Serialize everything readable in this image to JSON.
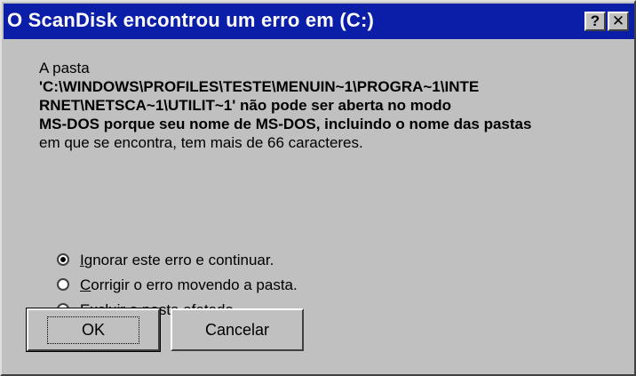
{
  "window": {
    "title": "O ScanDisk encontrou um erro em  (C:)",
    "help_glyph": "?",
    "close_glyph": "✕"
  },
  "message": {
    "lines": [
      "A pasta",
      "'C:\\WINDOWS\\PROFILES\\TESTE\\MENUIN~1\\PROGRA~1\\INTE",
      "RNET\\NETSCA~1\\UTILIT~1' não pode ser aberta no modo",
      "MS-DOS porque seu nome de MS-DOS, incluindo o nome das pastas",
      "em que se encontra, tem mais de 66 caracteres."
    ]
  },
  "options": [
    {
      "hotkey": "I",
      "rest": "gnorar este erro e continuar.",
      "selected": true
    },
    {
      "hotkey": "C",
      "rest": "orrigir o erro movendo a pasta.",
      "selected": false
    },
    {
      "hotkey": "E",
      "rest": "xcluir a pasta afetada.",
      "selected": false
    }
  ],
  "buttons": {
    "ok_label": "OK",
    "cancel_label": "Cancelar"
  },
  "colors": {
    "titlebar": "#0a1ea8",
    "face": "#c0c0c0"
  }
}
